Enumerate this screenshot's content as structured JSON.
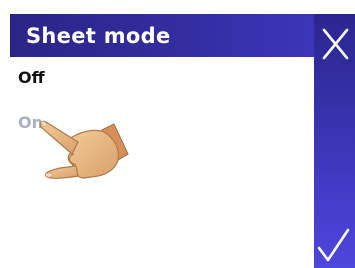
{
  "dialog": {
    "title": "Sheet mode"
  },
  "options": {
    "off_label": "Off",
    "on_label": "On"
  },
  "colors": {
    "header_dark": "#2a2585",
    "panel_bottom": "#4d46dc",
    "selected_text": "#111111",
    "unselected_text": "#a9b0c4"
  },
  "icons": {
    "close": "close-icon",
    "confirm": "checkmark-icon",
    "pointer": "pointing-hand-icon"
  }
}
